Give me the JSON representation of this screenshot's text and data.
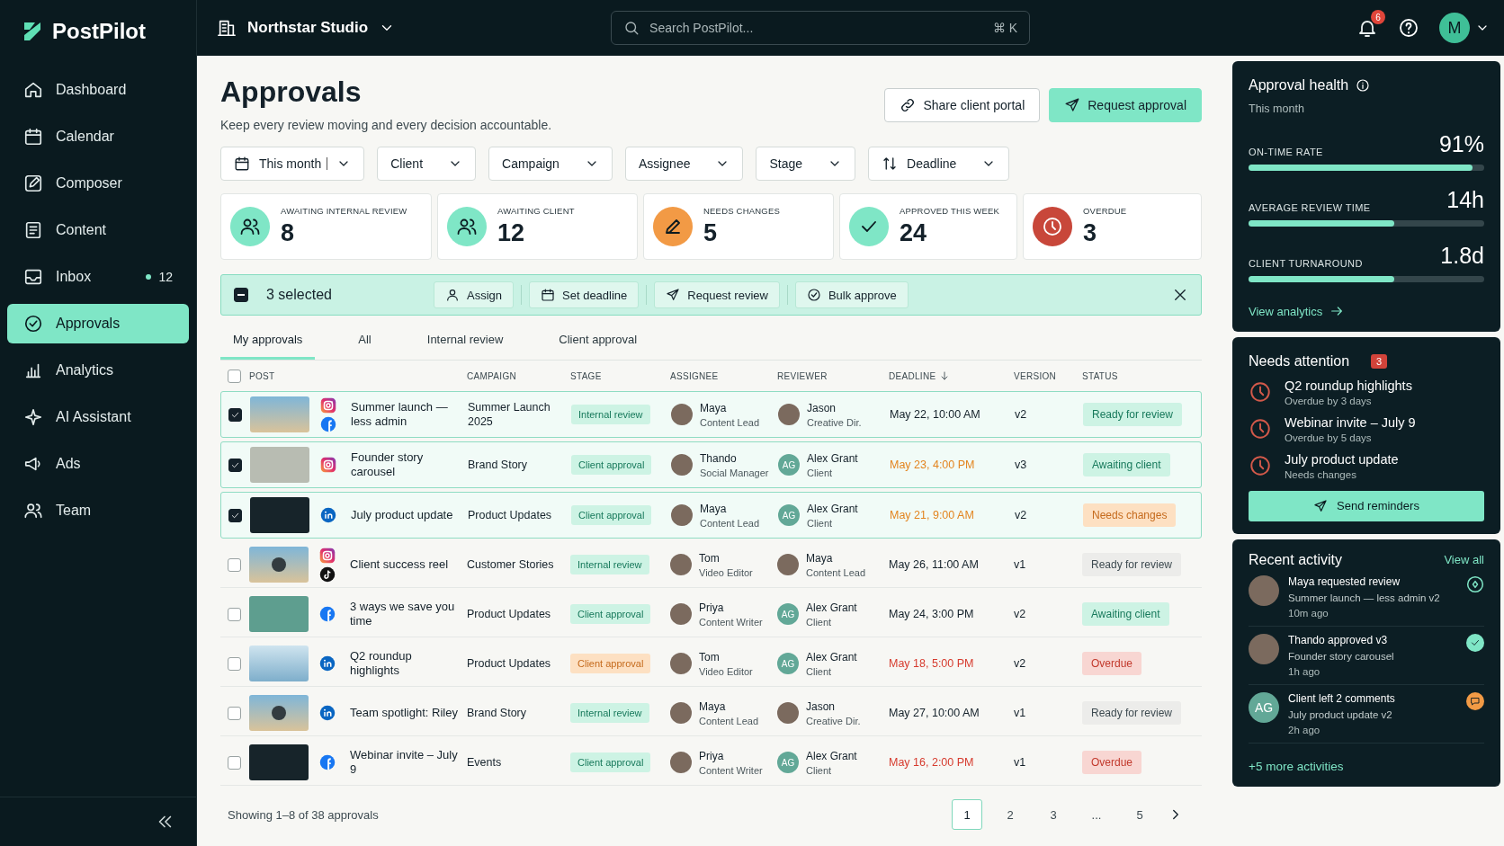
{
  "sidebar": {
    "logo": "PostPilot",
    "items": [
      {
        "label": "Dashboard",
        "selected": false
      },
      {
        "label": "Calendar",
        "selected": false
      },
      {
        "label": "Composer",
        "selected": false
      },
      {
        "label": "Content",
        "selected": false
      },
      {
        "label": "Inbox",
        "selected": false,
        "badge": "12"
      },
      {
        "label": "Approvals",
        "selected": true
      },
      {
        "label": "Analytics",
        "selected": false
      },
      {
        "label": "AI Assistant",
        "selected": false
      },
      {
        "label": "Ads",
        "selected": false
      },
      {
        "label": "Team",
        "selected": false
      }
    ]
  },
  "topbar": {
    "workspace": "Northstar Studio",
    "search": {
      "placeholder": "Search PostPilot...",
      "shortcut": "⌘ K"
    },
    "notifications": "6",
    "avatar": "M"
  },
  "page": {
    "title": "Approvals",
    "subtitle": "Keep every review moving and every decision accountable.",
    "actions": [
      {
        "label": "Share client portal",
        "kind": "secondary"
      },
      {
        "label": "Request approval",
        "kind": "primary"
      }
    ]
  },
  "filters": [
    {
      "label": "This month"
    },
    {
      "label": "Client"
    },
    {
      "label": "Campaign"
    },
    {
      "label": "Assignee"
    },
    {
      "label": "Stage"
    },
    {
      "label": "Deadline"
    }
  ],
  "stats": [
    {
      "label": "AWAITING INTERNAL REVIEW",
      "value": "8",
      "color": "#7fe6c6"
    },
    {
      "label": "AWAITING CLIENT",
      "value": "12",
      "color": "#7fe6c6"
    },
    {
      "label": "NEEDS CHANGES",
      "value": "5",
      "color": "#f29a45"
    },
    {
      "label": "APPROVED THIS WEEK",
      "value": "24",
      "color": "#7fe6c6"
    },
    {
      "label": "OVERDUE",
      "value": "3",
      "color": "#c8473a"
    }
  ],
  "bulk": {
    "indeterminate": true,
    "label": "3 selected",
    "actions": [
      {
        "label": "Assign"
      },
      {
        "label": "Set deadline"
      },
      {
        "label": "Request review"
      },
      {
        "label": "Bulk approve"
      }
    ]
  },
  "tabs": [
    {
      "label": "My approvals",
      "selected": true
    },
    {
      "label": "All",
      "selected": false
    },
    {
      "label": "Internal review",
      "selected": false
    },
    {
      "label": "Client approval",
      "selected": false
    }
  ],
  "table": {
    "all_checked": false,
    "columns": [
      {
        "label": "POST",
        "sorted": false
      },
      {
        "label": "CAMPAIGN",
        "sorted": false
      },
      {
        "label": "STAGE",
        "sorted": false
      },
      {
        "label": "ASSIGNEE",
        "sorted": false
      },
      {
        "label": "REVIEWER",
        "sorted": false
      },
      {
        "label": "DEADLINE",
        "sorted": true
      },
      {
        "label": "VERSION",
        "sorted": false
      },
      {
        "label": "STATUS",
        "sorted": false
      }
    ],
    "rows": [
      {
        "checked": true,
        "thumb": {
          "kind": "photo",
          "video": false
        },
        "platforms": [
          {
            "kind": "instagram"
          },
          {
            "kind": "facebook"
          }
        ],
        "title": "Summer launch — less admin",
        "campaign": "Summer Launch 2025",
        "stage": {
          "label": "Internal review",
          "kind": "success"
        },
        "assignee": {
          "name": "Maya",
          "role": "Content Lead",
          "avatar": {
            "kind": "photo"
          }
        },
        "reviewer": {
          "name": "Jason",
          "role": "Creative Dir.",
          "avatar": {
            "kind": "photo"
          }
        },
        "deadline": {
          "text": "May 22, 10:00 AM",
          "kind": "normal"
        },
        "version": "v2",
        "status": {
          "label": "Ready for review",
          "kind": "success"
        }
      },
      {
        "checked": true,
        "thumb": {
          "kind": "design",
          "video": false
        },
        "platforms": [
          {
            "kind": "instagram"
          }
        ],
        "title": "Founder story carousel",
        "campaign": "Brand Story",
        "stage": {
          "label": "Client approval",
          "kind": "success"
        },
        "assignee": {
          "name": "Thando",
          "role": "Social Manager",
          "avatar": {
            "kind": "photo"
          }
        },
        "reviewer": {
          "name": "Alex Grant",
          "role": "Client",
          "avatar": {
            "kind": "initials",
            "text": "AG"
          }
        },
        "deadline": {
          "text": "May 23, 4:00 PM",
          "kind": "warning"
        },
        "version": "v3",
        "status": {
          "label": "Awaiting client",
          "kind": "success"
        }
      },
      {
        "checked": true,
        "thumb": {
          "kind": "dark",
          "video": false
        },
        "platforms": [
          {
            "kind": "linkedin"
          }
        ],
        "title": "July product update",
        "campaign": "Product Updates",
        "stage": {
          "label": "Client approval",
          "kind": "success"
        },
        "assignee": {
          "name": "Maya",
          "role": "Content Lead",
          "avatar": {
            "kind": "photo"
          }
        },
        "reviewer": {
          "name": "Alex Grant",
          "role": "Client",
          "avatar": {
            "kind": "initials",
            "text": "AG"
          }
        },
        "deadline": {
          "text": "May 21, 9:00 AM",
          "kind": "warning"
        },
        "version": "v2",
        "status": {
          "label": "Needs changes",
          "kind": "warning"
        }
      },
      {
        "checked": false,
        "thumb": {
          "kind": "photo",
          "video": true
        },
        "platforms": [
          {
            "kind": "instagram"
          },
          {
            "kind": "tiktok"
          }
        ],
        "title": "Client success reel",
        "campaign": "Customer Stories",
        "stage": {
          "label": "Internal review",
          "kind": "success"
        },
        "assignee": {
          "name": "Tom",
          "role": "Video Editor",
          "avatar": {
            "kind": "photo"
          }
        },
        "reviewer": {
          "name": "Maya",
          "role": "Content Lead",
          "avatar": {
            "kind": "photo"
          }
        },
        "deadline": {
          "text": "May 26, 11:00 AM",
          "kind": "normal"
        },
        "version": "v1",
        "status": {
          "label": "Ready for review",
          "kind": "neutral"
        }
      },
      {
        "checked": false,
        "thumb": {
          "kind": "teal",
          "video": false
        },
        "platforms": [
          {
            "kind": "facebook"
          }
        ],
        "title": "3 ways we save you time",
        "campaign": "Product Updates",
        "stage": {
          "label": "Client approval",
          "kind": "success"
        },
        "assignee": {
          "name": "Priya",
          "role": "Content Writer",
          "avatar": {
            "kind": "photo"
          }
        },
        "reviewer": {
          "name": "Alex Grant",
          "role": "Client",
          "avatar": {
            "kind": "initials",
            "text": "AG"
          }
        },
        "deadline": {
          "text": "May 24, 3:00 PM",
          "kind": "normal"
        },
        "version": "v2",
        "status": {
          "label": "Awaiting client",
          "kind": "success"
        }
      },
      {
        "checked": false,
        "thumb": {
          "kind": "sky",
          "video": false
        },
        "platforms": [
          {
            "kind": "linkedin"
          }
        ],
        "title": "Q2 roundup highlights",
        "campaign": "Product Updates",
        "stage": {
          "label": "Client approval",
          "kind": "warning"
        },
        "assignee": {
          "name": "Tom",
          "role": "Video Editor",
          "avatar": {
            "kind": "photo"
          }
        },
        "reviewer": {
          "name": "Alex Grant",
          "role": "Client",
          "avatar": {
            "kind": "initials",
            "text": "AG"
          }
        },
        "deadline": {
          "text": "May 18, 5:00 PM",
          "kind": "danger"
        },
        "version": "v2",
        "status": {
          "label": "Overdue",
          "kind": "danger"
        }
      },
      {
        "checked": false,
        "thumb": {
          "kind": "photo",
          "video": true
        },
        "platforms": [
          {
            "kind": "linkedin"
          }
        ],
        "title": "Team spotlight: Riley",
        "campaign": "Brand Story",
        "stage": {
          "label": "Internal review",
          "kind": "success"
        },
        "assignee": {
          "name": "Maya",
          "role": "Content Lead",
          "avatar": {
            "kind": "photo"
          }
        },
        "reviewer": {
          "name": "Jason",
          "role": "Creative Dir.",
          "avatar": {
            "kind": "photo"
          }
        },
        "deadline": {
          "text": "May 27, 10:00 AM",
          "kind": "normal"
        },
        "version": "v1",
        "status": {
          "label": "Ready for review",
          "kind": "neutral"
        }
      },
      {
        "checked": false,
        "thumb": {
          "kind": "dark",
          "video": false
        },
        "platforms": [
          {
            "kind": "facebook"
          }
        ],
        "title": "Webinar invite – July 9",
        "campaign": "Events",
        "stage": {
          "label": "Client approval",
          "kind": "success"
        },
        "assignee": {
          "name": "Priya",
          "role": "Content Writer",
          "avatar": {
            "kind": "photo"
          }
        },
        "reviewer": {
          "name": "Alex Grant",
          "role": "Client",
          "avatar": {
            "kind": "initials",
            "text": "AG"
          }
        },
        "deadline": {
          "text": "May 16, 2:00 PM",
          "kind": "danger"
        },
        "version": "v1",
        "status": {
          "label": "Overdue",
          "kind": "danger"
        }
      }
    ]
  },
  "footer": {
    "summary": "Showing 1–8 of 38 approvals",
    "pages": [
      {
        "label": "1",
        "selected": true
      },
      {
        "label": "2",
        "selected": false
      },
      {
        "label": "3",
        "selected": false
      },
      {
        "label": "...",
        "selected": false
      },
      {
        "label": "5",
        "selected": false
      }
    ]
  },
  "health": {
    "title": "Approval health",
    "subtitle": "This month",
    "metrics": [
      {
        "label": "ON-TIME RATE",
        "value": "91%",
        "level": 0.95
      },
      {
        "label": "AVERAGE REVIEW TIME",
        "value": "14h",
        "level": 0.62
      },
      {
        "label": "CLIENT TURNAROUND",
        "value": "1.8d",
        "level": 0.62
      }
    ],
    "link": "View analytics"
  },
  "attention": {
    "title": "Needs attention",
    "count": "3",
    "items": [
      {
        "title": "Q2 roundup highlights",
        "detail": "Overdue by 3 days"
      },
      {
        "title": "Webinar invite – July 9",
        "detail": "Overdue by 5 days"
      },
      {
        "title": "July product update",
        "detail": "Needs changes"
      }
    ],
    "button": "Send reminders"
  },
  "activity": {
    "title": "Recent activity",
    "link": "View all",
    "items": [
      {
        "title": "Maya requested review",
        "detail": "Summer launch — less admin v2",
        "time": "10m ago",
        "avatar": {
          "kind": "photo"
        },
        "kind": "pending"
      },
      {
        "title": "Thando approved v3",
        "detail": "Founder story carousel",
        "time": "1h ago",
        "avatar": {
          "kind": "photo"
        },
        "kind": "approved"
      },
      {
        "title": "Client left 2 comments",
        "detail": "July product update v2",
        "time": "2h ago",
        "avatar": {
          "kind": "initials",
          "text": "AG"
        },
        "kind": "comment"
      }
    ],
    "more": "+5 more activities"
  }
}
